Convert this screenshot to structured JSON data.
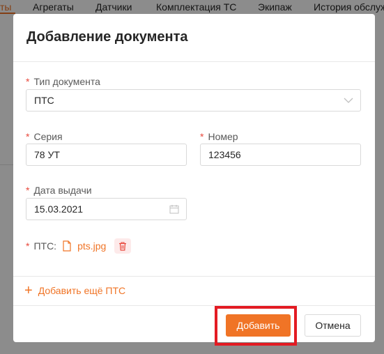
{
  "background_tabs": [
    {
      "label": "ты",
      "active": true
    },
    {
      "label": "Агрегаты",
      "active": false
    },
    {
      "label": "Датчики",
      "active": false
    },
    {
      "label": "Комплектация ТС",
      "active": false
    },
    {
      "label": "Экипаж",
      "active": false
    },
    {
      "label": "История обслуж",
      "active": false
    }
  ],
  "modal": {
    "title": "Добавление документа",
    "doc_type": {
      "label": "Тип документа",
      "value": "ПТС",
      "icon": "chevron-down-icon"
    },
    "series": {
      "label": "Серия",
      "value": "78 УТ"
    },
    "number": {
      "label": "Номер",
      "value": "123456"
    },
    "issue_date": {
      "label": "Дата выдачи",
      "value": "15.03.2021",
      "icon": "calendar-icon"
    },
    "attachment": {
      "label": "ПТС:",
      "file_name": "pts.jpg",
      "file_icon": "file-icon",
      "delete_icon": "trash-icon"
    },
    "add_more": {
      "icon": "plus-icon",
      "label": "Добавить ещё ПТС"
    },
    "buttons": {
      "submit": "Добавить",
      "cancel": "Отмена"
    },
    "required_mark": "*"
  },
  "colors": {
    "accent": "#f07426",
    "required": "#e8483c",
    "delete": "#e8483c",
    "highlight": "#e31b23"
  }
}
